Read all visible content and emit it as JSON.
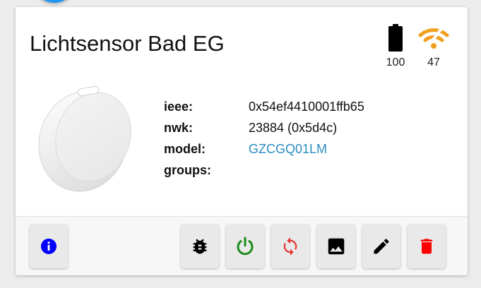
{
  "device": {
    "title": "Lichtsensor Bad EG",
    "battery": "100",
    "linkquality": "47"
  },
  "info": {
    "rows": [
      {
        "key": "ieee:",
        "value": "0x54ef4410001ffb65"
      },
      {
        "key": "nwk:",
        "value": "23884 (0x5d4c)"
      },
      {
        "key": "model:",
        "value": "GZCGQ01LM"
      },
      {
        "key": "groups:",
        "value": ""
      }
    ]
  },
  "actions": [
    {
      "icon": "info-icon",
      "color": "#0000ff"
    },
    {
      "icon": "bug-icon",
      "color": "#000000"
    },
    {
      "icon": "power-icon",
      "color": "#1a8a1a"
    },
    {
      "icon": "sync-icon",
      "color": "#e53935"
    },
    {
      "icon": "image-icon",
      "color": "#000000"
    },
    {
      "icon": "edit-icon",
      "color": "#000000"
    },
    {
      "icon": "delete-icon",
      "color": "#ff0000"
    }
  ],
  "colors": {
    "accent": "#2196f3",
    "signal": "#f0a020",
    "link": "#2b8cc4"
  }
}
